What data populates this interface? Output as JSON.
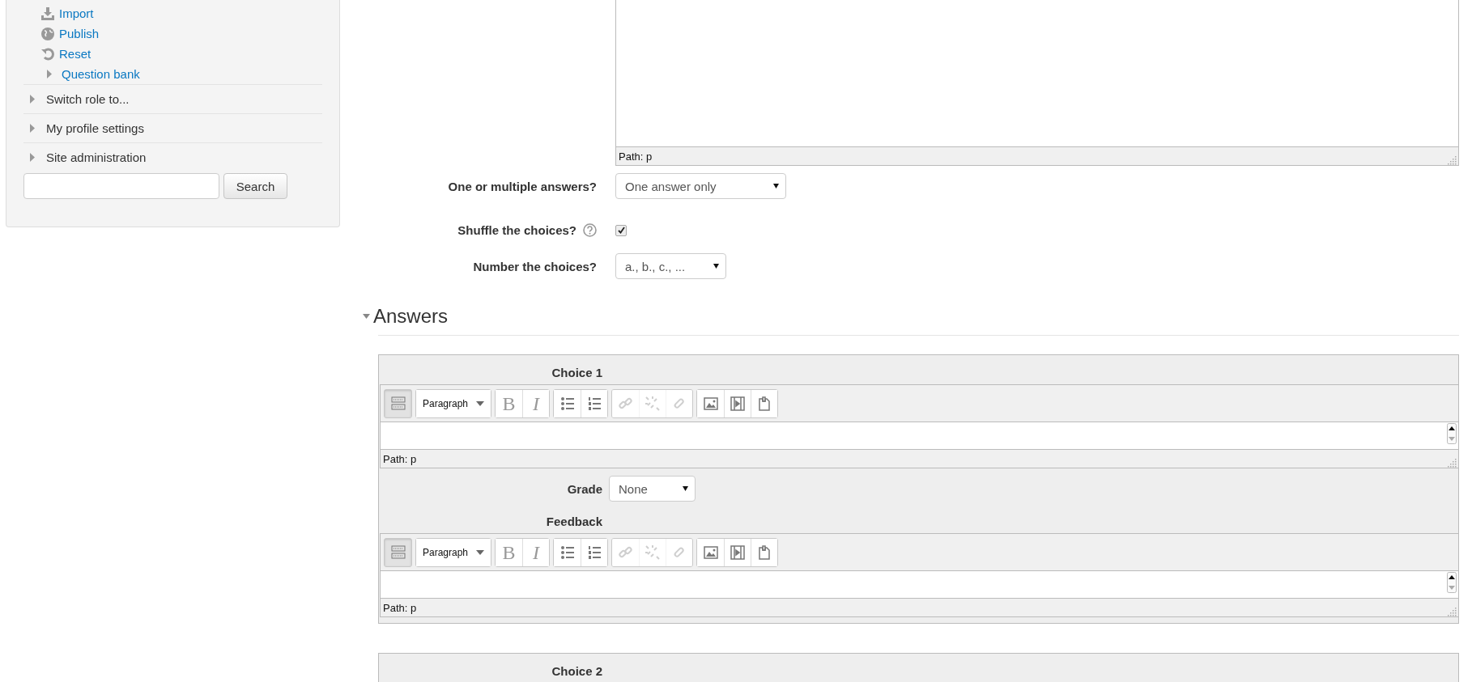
{
  "sidebar": {
    "links": [
      {
        "kind": "import",
        "label": "Import"
      },
      {
        "kind": "publish",
        "label": "Publish"
      },
      {
        "kind": "reset",
        "label": "Reset"
      },
      {
        "kind": "branch",
        "label": "Question bank",
        "expanded": false
      }
    ],
    "sections": [
      {
        "label": "Switch role to...",
        "expanded": false
      },
      {
        "label": "My profile settings",
        "expanded": false
      },
      {
        "label": "Site administration",
        "expanded": false
      }
    ],
    "search": {
      "button": "Search"
    }
  },
  "main": {
    "top_editor": {
      "path": "Path: p"
    },
    "fields": [
      {
        "kind": "select",
        "label": "One or multiple answers?",
        "value": "One answer only"
      },
      {
        "kind": "checkbox",
        "label": "Shuffle the choices?",
        "help": true,
        "checked": true
      },
      {
        "kind": "select",
        "label": "Number the choices?",
        "value": "a., b., c., ..."
      }
    ],
    "answers": {
      "title": "Answers",
      "expanded": true,
      "choices": [
        {
          "label": "Choice 1",
          "editor": {
            "path": "Path: p",
            "toolbar": [
              {
                "buttons": [
                  {
                    "kind": "toggle",
                    "pressed": true,
                    "disabled": false
                  }
                ]
              },
              {
                "buttons": [
                  {
                    "kind": "format",
                    "label": "Paragraph",
                    "pressed": false,
                    "disabled": false
                  }
                ]
              },
              {
                "buttons": [
                  {
                    "kind": "bold",
                    "label": "B",
                    "pressed": false,
                    "disabled": false
                  },
                  {
                    "kind": "italic",
                    "label": "I",
                    "pressed": false,
                    "disabled": false
                  }
                ]
              },
              {
                "buttons": [
                  {
                    "kind": "bullets",
                    "pressed": false,
                    "disabled": false
                  },
                  {
                    "kind": "numbers",
                    "pressed": false,
                    "disabled": false
                  }
                ]
              },
              {
                "buttons": [
                  {
                    "kind": "link",
                    "pressed": false,
                    "disabled": true
                  },
                  {
                    "kind": "unlink",
                    "pressed": false,
                    "disabled": true
                  },
                  {
                    "kind": "nolink",
                    "pressed": false,
                    "disabled": true
                  }
                ]
              },
              {
                "buttons": [
                  {
                    "kind": "image",
                    "pressed": false,
                    "disabled": false
                  },
                  {
                    "kind": "media",
                    "pressed": false,
                    "disabled": false
                  },
                  {
                    "kind": "files",
                    "pressed": false,
                    "disabled": false
                  }
                ]
              }
            ]
          },
          "grade": {
            "label": "Grade",
            "value": "None"
          },
          "feedback": {
            "label": "Feedback",
            "editor": {
              "path": "Path: p",
              "toolbar": [
                {
                  "buttons": [
                    {
                      "kind": "toggle",
                      "pressed": true,
                      "disabled": false
                    }
                  ]
                },
                {
                  "buttons": [
                    {
                      "kind": "format",
                      "label": "Paragraph",
                      "pressed": false,
                      "disabled": false
                    }
                  ]
                },
                {
                  "buttons": [
                    {
                      "kind": "bold",
                      "label": "B",
                      "pressed": false,
                      "disabled": false
                    },
                    {
                      "kind": "italic",
                      "label": "I",
                      "pressed": false,
                      "disabled": false
                    }
                  ]
                },
                {
                  "buttons": [
                    {
                      "kind": "bullets",
                      "pressed": false,
                      "disabled": false
                    },
                    {
                      "kind": "numbers",
                      "pressed": false,
                      "disabled": false
                    }
                  ]
                },
                {
                  "buttons": [
                    {
                      "kind": "link",
                      "pressed": false,
                      "disabled": true
                    },
                    {
                      "kind": "unlink",
                      "pressed": false,
                      "disabled": true
                    },
                    {
                      "kind": "nolink",
                      "pressed": false,
                      "disabled": true
                    }
                  ]
                },
                {
                  "buttons": [
                    {
                      "kind": "image",
                      "pressed": false,
                      "disabled": false
                    },
                    {
                      "kind": "media",
                      "pressed": false,
                      "disabled": false
                    },
                    {
                      "kind": "files",
                      "pressed": false,
                      "disabled": false
                    }
                  ]
                }
              ]
            }
          }
        },
        {
          "label": "Choice 2"
        }
      ]
    }
  }
}
